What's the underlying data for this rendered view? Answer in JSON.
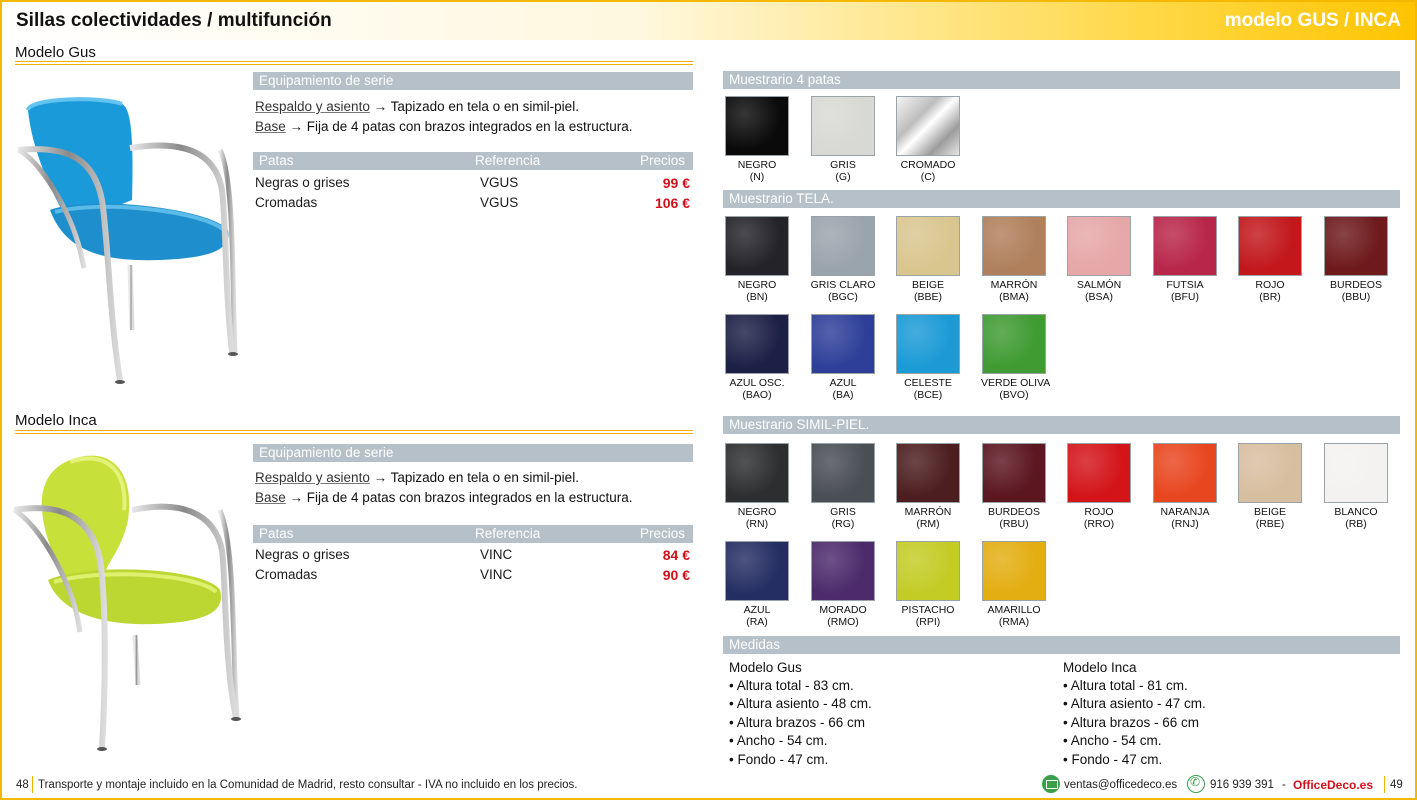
{
  "header": {
    "title": "Sillas colectividades / multifunción",
    "model": "modelo GUS / INCA"
  },
  "gus": {
    "heading": "Modelo Gus",
    "equip_title": "Equipamiento de serie",
    "line1_link": "Respaldo y asiento",
    "line1_text": " → Tapizado en tela o en simil-piel.",
    "line2_link": "Base",
    "line2_text": " → Fija de 4 patas con brazos integrados en la estructura.",
    "table_headers": [
      "Patas",
      "Referencia",
      "Precios"
    ],
    "rows": [
      {
        "patas": "Negras o grises",
        "ref": "VGUS",
        "precio": "99 €"
      },
      {
        "patas": "Cromadas",
        "ref": "VGUS",
        "precio": "106 €"
      }
    ],
    "chair_color": "#1a9ad9"
  },
  "inca": {
    "heading": "Modelo Inca",
    "equip_title": "Equipamiento de serie",
    "line1_link": "Respaldo y asiento",
    "line1_text": " → Tapizado en tela o en simil-piel.",
    "line2_link": "Base",
    "line2_text": " → Fija de 4 patas con brazos integrados en la estructura.",
    "table_headers": [
      "Patas",
      "Referencia",
      "Precios"
    ],
    "rows": [
      {
        "patas": "Negras o grises",
        "ref": "VINC",
        "precio": "84 €"
      },
      {
        "patas": "Cromadas",
        "ref": "VINC",
        "precio": "90 €"
      }
    ],
    "chair_color": "#c8e03a"
  },
  "muestrario_patas": {
    "title": "Muestrario 4 patas",
    "items": [
      {
        "name": "NEGRO",
        "code": "(N)",
        "color": "#0a0a0a"
      },
      {
        "name": "GRIS",
        "code": "(G)",
        "color": "#d8d8d4"
      },
      {
        "name": "CROMADO",
        "code": "(C)",
        "color": "#c8c8c8"
      }
    ]
  },
  "muestrario_tela": {
    "title": "Muestrario TELA.",
    "items": [
      {
        "name": "NEGRO",
        "code": "(BN)",
        "color": "#24232a"
      },
      {
        "name": "GRIS CLARO",
        "code": "(BGC)",
        "color": "#9aa4ad"
      },
      {
        "name": "BEIGE",
        "code": "(BBE)",
        "color": "#d9c68f"
      },
      {
        "name": "MARRÓN",
        "code": "(BMA)",
        "color": "#b0805c"
      },
      {
        "name": "SALMÓN",
        "code": "(BSA)",
        "color": "#e6a7a8"
      },
      {
        "name": "FUTSIA",
        "code": "(BFU)",
        "color": "#b8264a"
      },
      {
        "name": "ROJO",
        "code": "(BR)",
        "color": "#c2181c"
      },
      {
        "name": "BURDEOS",
        "code": "(BBU)",
        "color": "#6e1a1c"
      },
      {
        "name": "AZUL OSC.",
        "code": "(BAO)",
        "color": "#1d2046"
      },
      {
        "name": "AZUL",
        "code": "(BA)",
        "color": "#2e3f99"
      },
      {
        "name": "CELESTE",
        "code": "(BCE)",
        "color": "#1b9ad6"
      },
      {
        "name": "VERDE OLIVA",
        "code": "(BVO)",
        "color": "#3f9b32"
      }
    ]
  },
  "muestrario_simil": {
    "title": "Muestrario SIMIL-PIEL.",
    "items": [
      {
        "name": "NEGRO",
        "code": "(RN)",
        "color": "#2d2e30"
      },
      {
        "name": "GRIS",
        "code": "(RG)",
        "color": "#4a4e55"
      },
      {
        "name": "MARRÓN",
        "code": "(RM)",
        "color": "#4c1e1f"
      },
      {
        "name": "BURDEOS",
        "code": "(RBU)",
        "color": "#5b1620"
      },
      {
        "name": "ROJO",
        "code": "(RRO)",
        "color": "#d3151a"
      },
      {
        "name": "NARANJA",
        "code": "(RNJ)",
        "color": "#e8461f"
      },
      {
        "name": "BEIGE",
        "code": "(RBE)",
        "color": "#d8bea0"
      },
      {
        "name": "BLANCO",
        "code": "(RB)",
        "color": "#f3f2f0"
      },
      {
        "name": "AZUL",
        "code": "(RA)",
        "color": "#252e63"
      },
      {
        "name": "MORADO",
        "code": "(RMO)",
        "color": "#4c2a6b"
      },
      {
        "name": "PISTACHO",
        "code": "(RPI)",
        "color": "#c3cc25"
      },
      {
        "name": "AMARILLO",
        "code": "(RMA)",
        "color": "#e3ae12"
      }
    ]
  },
  "medidas": {
    "title": "Medidas",
    "gus": {
      "title": "Modelo Gus",
      "items": [
        "• Altura total - 83 cm.",
        "• Altura asiento - 48 cm.",
        "• Altura brazos - 66 cm",
        "• Ancho - 54 cm.",
        "• Fondo - 47 cm."
      ]
    },
    "inca": {
      "title": "Modelo Inca",
      "items": [
        "• Altura total - 81 cm.",
        "• Altura asiento - 47 cm.",
        "• Altura brazos - 66 cm",
        "• Ancho - 54 cm.",
        "• Fondo - 47 cm."
      ]
    }
  },
  "footer": {
    "page_left": "48",
    "text": "Transporte y montaje incluido en la Comunidad de Madrid, resto consultar - IVA no incluido en los precios.",
    "email": "ventas@officedeco.es",
    "phone": "916 939 391",
    "dash": "-",
    "brand": "OfficeDeco.es",
    "page_right": "49"
  }
}
